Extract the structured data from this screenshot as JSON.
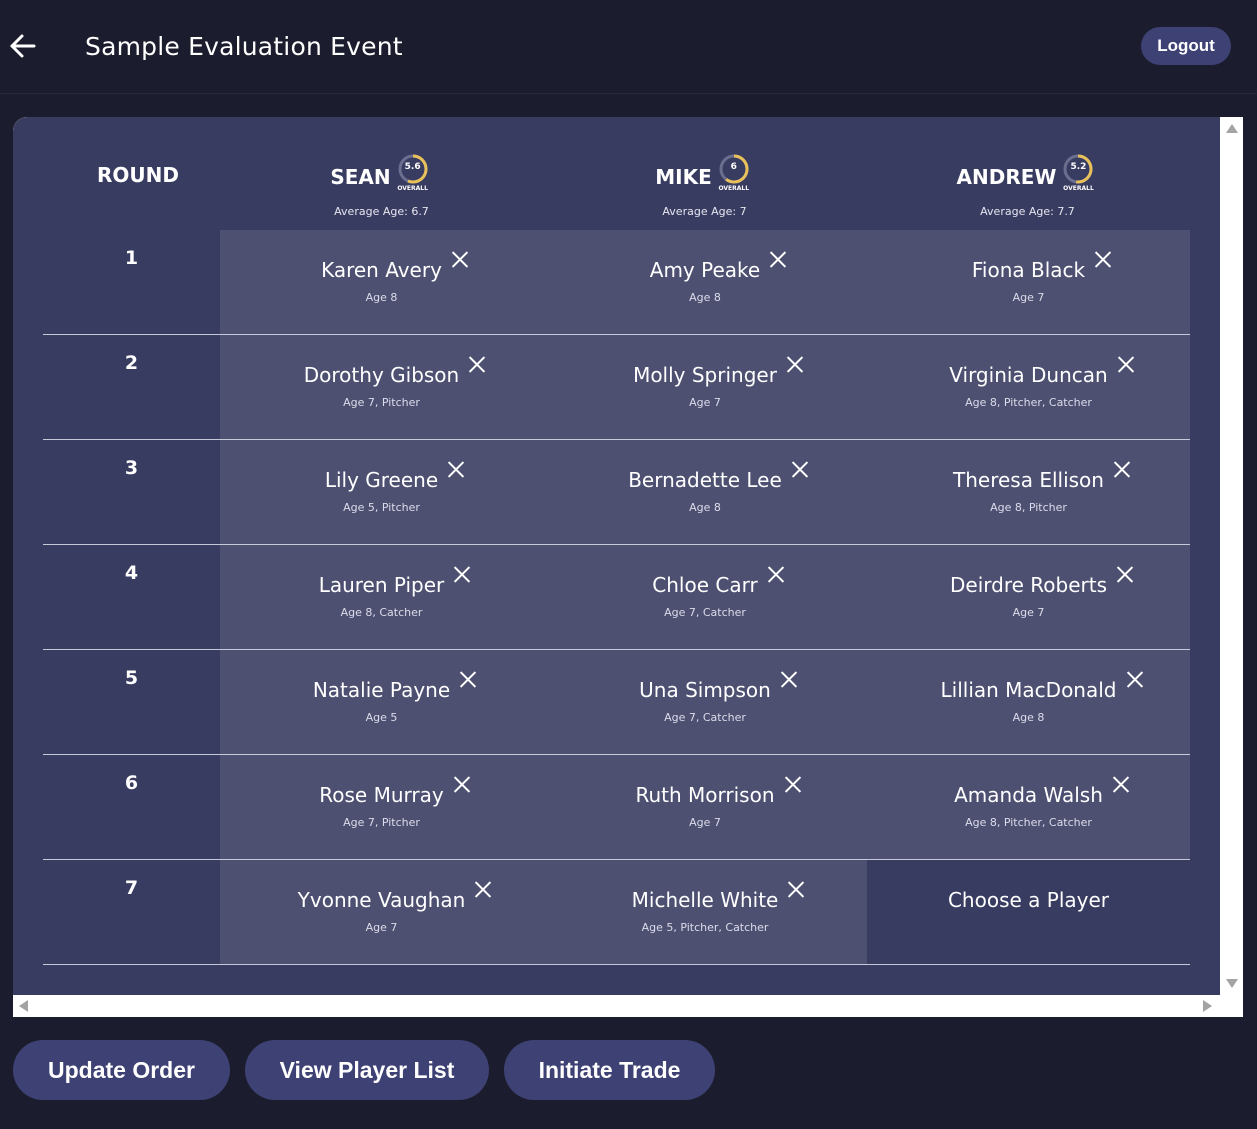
{
  "header": {
    "title": "Sample Evaluation Event",
    "logout_label": "Logout",
    "back_icon": "arrow-left-icon"
  },
  "board": {
    "round_label": "ROUND",
    "teams": [
      {
        "name": "SEAN",
        "rating": "5.6",
        "rating_label": "OVERALL",
        "rating_fraction": 0.56,
        "avg_age": "Average Age: 6.7"
      },
      {
        "name": "MIKE",
        "rating": "6",
        "rating_label": "OVERALL",
        "rating_fraction": 0.6,
        "avg_age": "Average Age: 7"
      },
      {
        "name": "ANDREW",
        "rating": "5.2",
        "rating_label": "OVERALL",
        "rating_fraction": 0.52,
        "avg_age": "Average Age: 7.7"
      }
    ],
    "rounds": [
      {
        "number": "1",
        "picks": [
          {
            "name": "Karen Avery",
            "info": "Age 8"
          },
          {
            "name": "Amy Peake",
            "info": "Age 8"
          },
          {
            "name": "Fiona Black",
            "info": "Age 7"
          }
        ]
      },
      {
        "number": "2",
        "picks": [
          {
            "name": "Dorothy Gibson",
            "info": "Age 7, Pitcher"
          },
          {
            "name": "Molly Springer",
            "info": "Age 7"
          },
          {
            "name": "Virginia Duncan",
            "info": "Age 8, Pitcher, Catcher"
          }
        ]
      },
      {
        "number": "3",
        "picks": [
          {
            "name": "Lily Greene",
            "info": "Age 5, Pitcher"
          },
          {
            "name": "Bernadette Lee",
            "info": "Age 8"
          },
          {
            "name": "Theresa Ellison",
            "info": "Age 8, Pitcher"
          }
        ]
      },
      {
        "number": "4",
        "picks": [
          {
            "name": "Lauren Piper",
            "info": "Age 8, Catcher"
          },
          {
            "name": "Chloe Carr",
            "info": "Age 7, Catcher"
          },
          {
            "name": "Deirdre Roberts",
            "info": "Age 7"
          }
        ]
      },
      {
        "number": "5",
        "picks": [
          {
            "name": "Natalie Payne",
            "info": "Age 5"
          },
          {
            "name": "Una Simpson",
            "info": "Age 7, Catcher"
          },
          {
            "name": "Lillian MacDonald",
            "info": "Age 8"
          }
        ]
      },
      {
        "number": "6",
        "picks": [
          {
            "name": "Rose Murray",
            "info": "Age 7, Pitcher"
          },
          {
            "name": "Ruth Morrison",
            "info": "Age 7"
          },
          {
            "name": "Amanda Walsh",
            "info": "Age 8, Pitcher, Catcher"
          }
        ]
      },
      {
        "number": "7",
        "picks": [
          {
            "name": "Yvonne Vaughan",
            "info": "Age 7"
          },
          {
            "name": "Michelle White",
            "info": "Age 5, Pitcher, Catcher"
          },
          {
            "choose": "Choose a Player"
          }
        ]
      }
    ]
  },
  "actions": {
    "update_order": "Update Order",
    "view_player_list": "View Player List",
    "initiate_trade": "Initiate Trade"
  },
  "colors": {
    "background": "#1b1c2d",
    "board": "#393c61",
    "cell": "#4e5072",
    "button": "#3d4173",
    "rating_ring": "#e8c15a"
  }
}
